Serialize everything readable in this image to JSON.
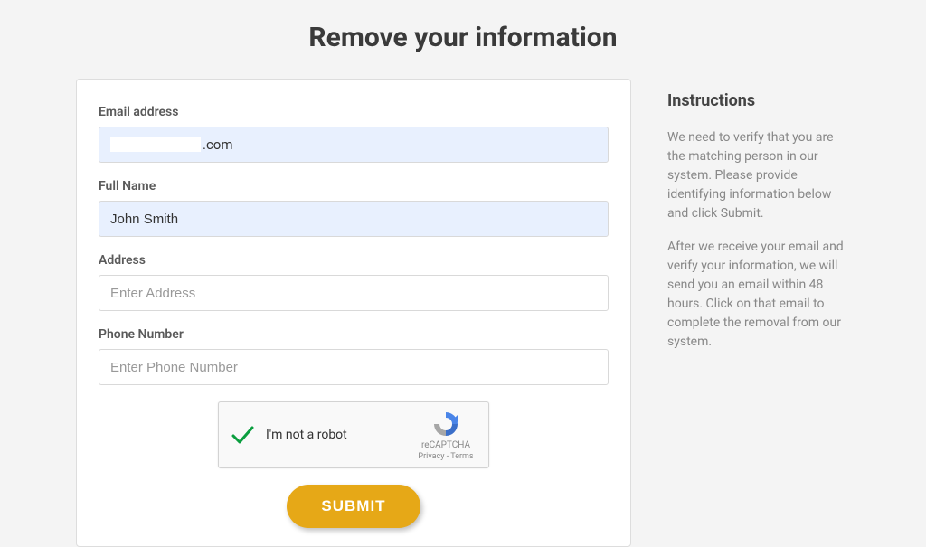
{
  "page_title": "Remove your information",
  "form": {
    "email": {
      "label": "Email address",
      "value_suffix": ".com"
    },
    "fullname": {
      "label": "Full Name",
      "value": "John Smith"
    },
    "address": {
      "label": "Address",
      "placeholder": "Enter Address"
    },
    "phone": {
      "label": "Phone Number",
      "placeholder": "Enter Phone Number"
    },
    "captcha": {
      "label": "I'm not a robot",
      "brand": "reCAPTCHA",
      "privacy": "Privacy",
      "terms": "Terms",
      "separator": " - "
    },
    "submit_label": "SUBMIT"
  },
  "instructions": {
    "title": "Instructions",
    "p1": "We need to verify that you are the matching person in our system. Please provide identifying information below and click Submit.",
    "p2": "After we receive your email and verify your information, we will send you an email within 48 hours. Click on that email to complete the removal from our system."
  }
}
